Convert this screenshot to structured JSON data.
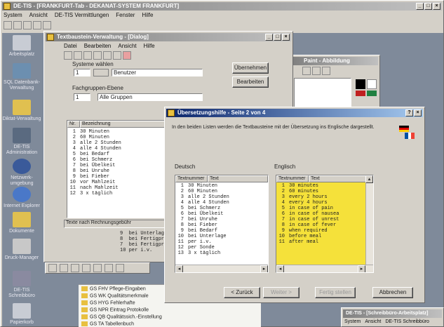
{
  "main_window": {
    "title": "DE-TIS - [FRANKFURT-Tab - DEKANAT-SYSTEM FRANKFURT]",
    "menu": [
      "System",
      "Ansicht",
      "DE-TIS Vermittlungen",
      "Fenster",
      "Hilfe"
    ]
  },
  "desktop_icons": [
    {
      "label": "Arbeitsplatz"
    },
    {
      "label": "SQL Datenbank-Verwaltung"
    },
    {
      "label": "Diktat-Verwaltung"
    },
    {
      "label": "DE-TIS Administration"
    },
    {
      "label": "Netzwerk-umgebung"
    },
    {
      "label": "Internet Explorer"
    },
    {
      "label": "Dokumente"
    },
    {
      "label": "Druck-Manager"
    },
    {
      "label": "DE-TIS Schreibbüro"
    },
    {
      "label": "Papierkorb"
    }
  ],
  "editor_window": {
    "title": "Textbaustein-Verwaltung - [Dialog]",
    "menu": [
      "Datei",
      "Bearbeiten",
      "Ansicht",
      "Hilfe"
    ],
    "system_field_label": "Systeme wählen",
    "system_value": "1",
    "system_name": "Benutzer",
    "professional_label": "Fachgruppen-Ebene",
    "professional_value": "1",
    "professional_name": "Alle Gruppen",
    "btn_uebernehmen": "Übernehmen",
    "btn_bearbeiten": "Bearbeiten",
    "col_nr": "Nr.",
    "col_bezeichnung": "Bezeichnung",
    "rows": [
      {
        "nr": "1",
        "text": "30 Minuten"
      },
      {
        "nr": "2",
        "text": "60 Minuten"
      },
      {
        "nr": "3",
        "text": "alle 2 Stunden"
      },
      {
        "nr": "4",
        "text": "alle 4 Stunden"
      },
      {
        "nr": "5",
        "text": "bei Bedarf"
      },
      {
        "nr": "6",
        "text": "bei Schmerz"
      },
      {
        "nr": "7",
        "text": "bei Übelkeit"
      },
      {
        "nr": "8",
        "text": "bei Unruhe"
      },
      {
        "nr": "9",
        "text": "bei Fieber"
      },
      {
        "nr": "10",
        "text": "vor Mahlzeit"
      },
      {
        "nr": "11",
        "text": "nach Mahlzeit"
      },
      {
        "nr": "12",
        "text": "3 x täglich"
      }
    ],
    "status": "Texte nach Rechnungsgebühr",
    "lower_rows": [
      "9  bei Unterlage",
      "8  bei Fertigprodukt",
      "7  bei Fertigprodukt",
      "10 per i.v."
    ]
  },
  "image_window": {
    "title": "Paint - Abbildung"
  },
  "dialog": {
    "title": "Übersetzungshilfe - Seite 2 von 4",
    "instruction": "In den beiden Listen werden die Textbausteine mit der Übersetzung ins Englische dargestellt.",
    "source_label": "Deutsch",
    "target_label": "Englisch",
    "col_nr": "Textnummer",
    "col_text": "Text",
    "source_rows": [
      {
        "nr": "1",
        "text": "30 Minuten"
      },
      {
        "nr": "2",
        "text": "60 Minuten"
      },
      {
        "nr": "3",
        "text": "alle 2 Stunden"
      },
      {
        "nr": "4",
        "text": "alle 4 Stunden"
      },
      {
        "nr": "5",
        "text": "bei Schmerz"
      },
      {
        "nr": "6",
        "text": "bei Übelkeit"
      },
      {
        "nr": "7",
        "text": "bei Unruhe"
      },
      {
        "nr": "8",
        "text": "bei Fieber"
      },
      {
        "nr": "9",
        "text": "bei Bedarf"
      },
      {
        "nr": "10",
        "text": "bei Unterlage"
      },
      {
        "nr": "11",
        "text": "per i.v."
      },
      {
        "nr": "12",
        "text": "per Sonde"
      },
      {
        "nr": "13",
        "text": "3 x täglich"
      }
    ],
    "target_rows": [
      {
        "nr": "1",
        "text": "30 minutes"
      },
      {
        "nr": "2",
        "text": "60 minutes"
      },
      {
        "nr": "3",
        "text": "every 2 hours"
      },
      {
        "nr": "4",
        "text": "every 4 hours"
      },
      {
        "nr": "5",
        "text": "in case of pain"
      },
      {
        "nr": "6",
        "text": "in case of nausea"
      },
      {
        "nr": "7",
        "text": "in case of unrest"
      },
      {
        "nr": "8",
        "text": "in case of fever"
      },
      {
        "nr": "9",
        "text": "when required"
      },
      {
        "nr": "10",
        "text": "before meal"
      },
      {
        "nr": "11",
        "text": "after meal"
      }
    ],
    "btn_back": "< Zurück",
    "btn_next": "Weiter >",
    "btn_finish": "Fertig stellen",
    "btn_cancel": "Abbrechen"
  },
  "tree": {
    "items": [
      "GS FHV Pflege-Eingaben",
      "GS WK Qualitätsmerkmale",
      "GS HYG Fehlerhafte",
      "GS NPR Eintrag Protokolle",
      "GS QB Qualitätssich.-Einstellung",
      "GS TA Tabellenbuch"
    ]
  },
  "mini_window": {
    "title": "DE-TIS - [Schreibbüro-Arbeitsplatz]",
    "menu": [
      "System",
      "Ansicht",
      "DE-TIS Schreibbüro"
    ]
  },
  "colors": {
    "desktop": "#7f8a9a",
    "highlight_list": "#f5e13a",
    "title_active": "#0a246a"
  }
}
